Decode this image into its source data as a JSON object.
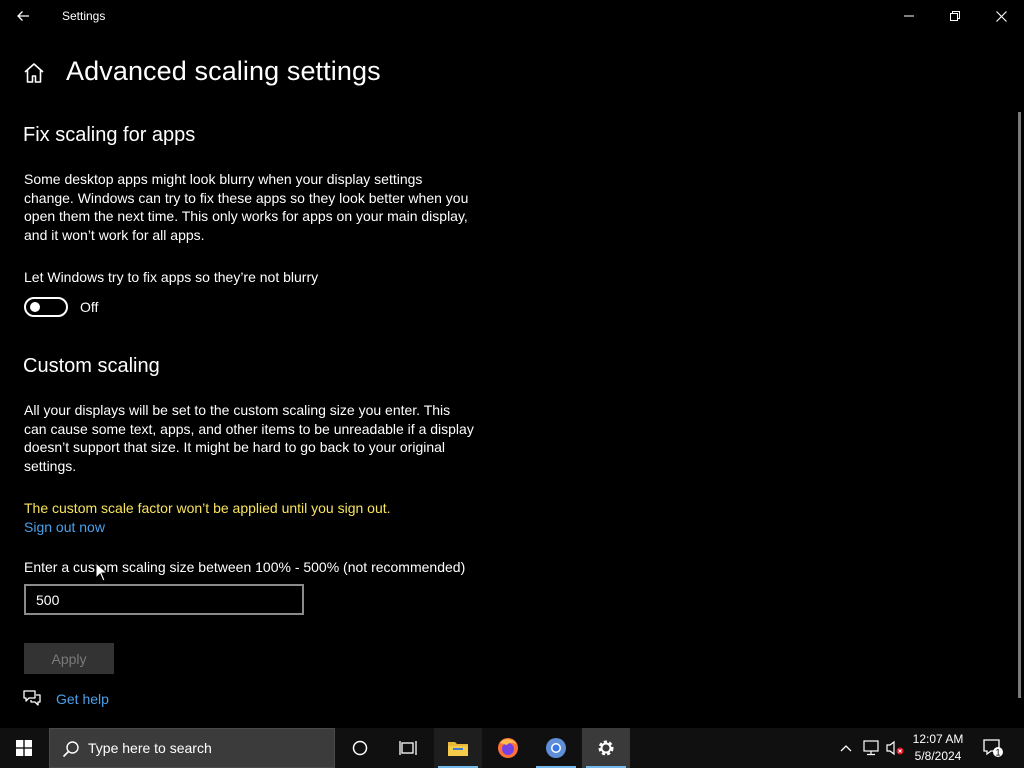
{
  "window": {
    "title": "Settings"
  },
  "page": {
    "title": "Advanced scaling settings"
  },
  "fix_scaling": {
    "heading": "Fix scaling for apps",
    "description_lines": [
      "Some desktop apps might look blurry when your display settings",
      "change. Windows can try to fix these apps so they look better when you",
      "open them the next time. This only works for apps on your main display,",
      "and it won’t work for all apps."
    ],
    "toggle_label": "Let Windows try to fix apps so they’re not blurry",
    "toggle_state": "Off"
  },
  "custom_scaling": {
    "heading": "Custom scaling",
    "description_lines": [
      "All your displays will be set to the custom scaling size you enter. This",
      "can cause some text, apps, and other items to be unreadable if a display",
      "doesn’t support that size. It might be hard to go back to your original",
      "settings."
    ],
    "warning": "The custom scale factor won’t be applied until you sign out.",
    "sign_out_link": "Sign out now",
    "input_label": "Enter a custom scaling size between 100% - 500% (not recommended)",
    "input_value": "500",
    "apply_label": "Apply"
  },
  "help": {
    "label": "Get help"
  },
  "taskbar": {
    "search_placeholder": "Type here to search",
    "time": "12:07 AM",
    "date": "5/8/2024",
    "notification_count": "1"
  },
  "colors": {
    "background": "#000000",
    "warning": "#f8e45c",
    "link": "#4aa0ea",
    "taskbar": "#101010",
    "accent": "#76b9ed"
  }
}
